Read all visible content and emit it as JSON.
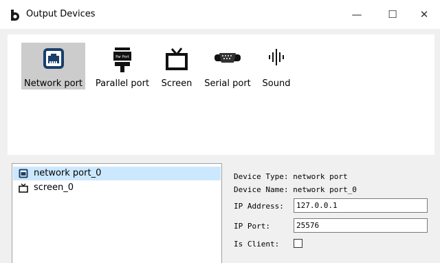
{
  "window": {
    "title": "Output Devices",
    "controls": {
      "minimize": "—",
      "maximize": "☐",
      "close": "✕"
    }
  },
  "toolbar": {
    "items": [
      {
        "label": "Network port",
        "icon": "network-port-icon",
        "selected": true
      },
      {
        "label": "Parallel port",
        "icon": "parallel-port-icon",
        "badge": "Par Port"
      },
      {
        "label": "Screen",
        "icon": "screen-icon"
      },
      {
        "label": "Serial port",
        "icon": "serial-port-icon"
      },
      {
        "label": "Sound",
        "icon": "sound-icon"
      }
    ]
  },
  "device_list": {
    "items": [
      {
        "label": "network port_0",
        "icon": "network-port-icon",
        "selected": true
      },
      {
        "label": "screen_0",
        "icon": "screen-icon"
      }
    ]
  },
  "properties": {
    "device_type_label": "Device Type:",
    "device_type_value": "network port",
    "device_name_label": "Device Name:",
    "device_name_value": "network port_0",
    "ip_address_label": "IP Address:",
    "ip_address_value": "127.0.0.1",
    "ip_port_label": "IP Port:",
    "ip_port_value": "25576",
    "is_client_label": "Is Client:",
    "is_client_checked": false
  },
  "colors": {
    "selected_tool_bg": "#cccccc",
    "selected_list_bg": "#cce8ff",
    "network_icon_blue": "#1a3f6b"
  }
}
